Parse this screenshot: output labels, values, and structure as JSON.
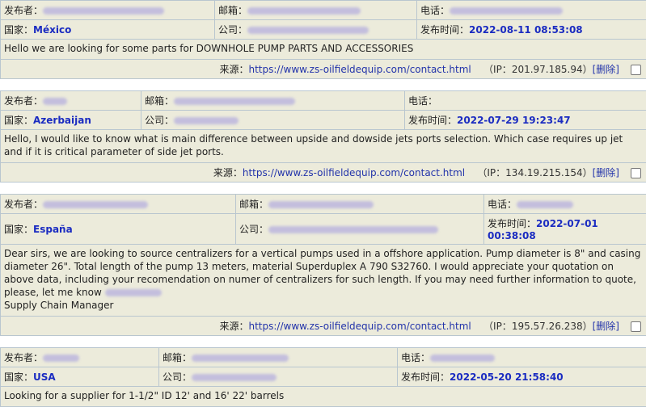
{
  "labels": {
    "publisher": "发布者：",
    "email": "邮箱：",
    "phone": "电话：",
    "country": "国家：",
    "company": "公司：",
    "time": "发布时间：",
    "source": "来源：",
    "ip_open": "（IP：",
    "ip_close": "）",
    "delete": "[删除]"
  },
  "messages": [
    {
      "country": "México",
      "time": "2022-08-11 08:53:08",
      "content": "Hello we are looking for some parts for DOWNHOLE PUMP PARTS AND ACCESSORIES",
      "source_url": "https://www.zs-oilfieldequip.com/contact.html",
      "ip": "201.97.185.94"
    },
    {
      "country": "Azerbaijan",
      "time": "2022-07-29 19:23:47",
      "content": "Hello, I would like to know what is main difference between upside and dowside jets ports selection. Which case requires up jet and if it is critical parameter of side jet ports.",
      "source_url": "https://www.zs-oilfieldequip.com/contact.html",
      "ip": "134.19.215.154"
    },
    {
      "country": "España",
      "time": "2022-07-01 00:38:08",
      "content": "Dear sirs, we are looking to source centralizers for a vertical pumps used in a offshore application. Pump diameter is 8\" and casing diameter 26\". Total length of the pump 13 meters, material Superduplex A 790 S32760. I would appreciate your quotation on above data, including your recomendation on numer of centralizers for such length. If you may need further information to quote, please, let me know",
      "signature": "Supply Chain Manager",
      "source_url": "https://www.zs-oilfieldequip.com/contact.html",
      "ip": "195.57.26.238"
    },
    {
      "country": "USA",
      "time": "2022-05-20 21:58:40",
      "content": "Looking for a supplier for 1-1/2\" ID 12' and 16' 22' barrels"
    }
  ]
}
